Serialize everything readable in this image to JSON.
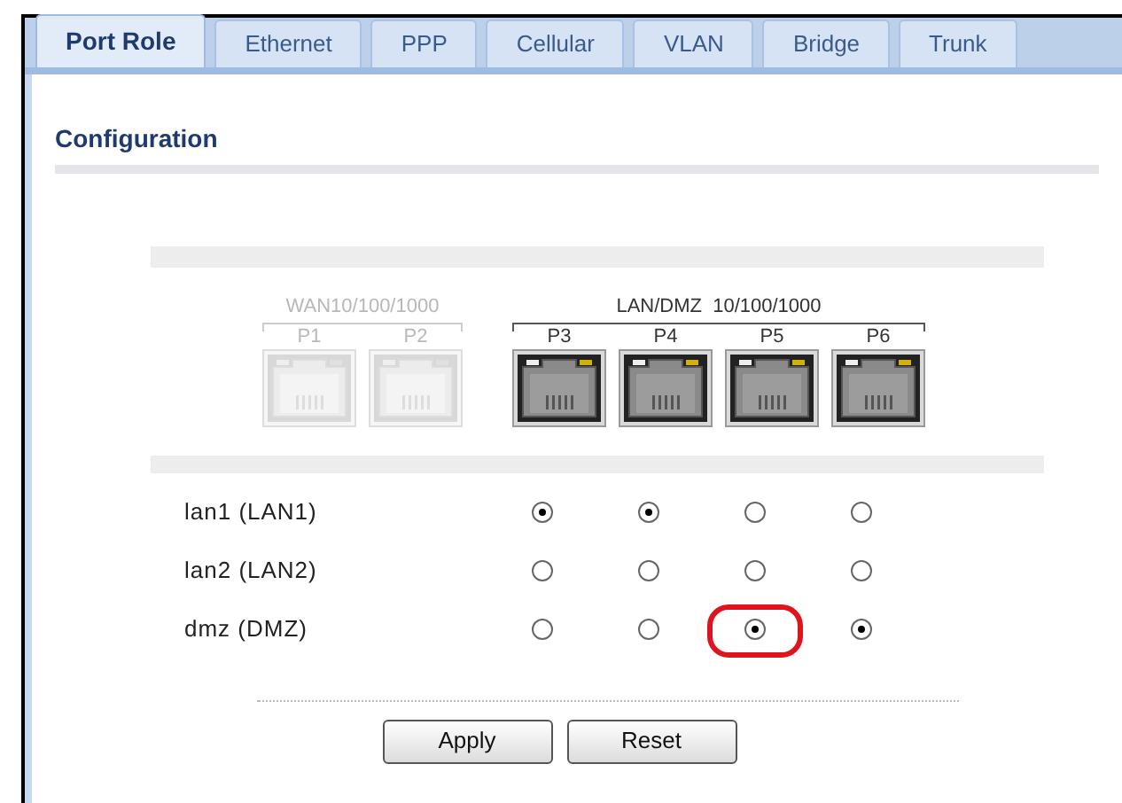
{
  "tabs": [
    {
      "label": "Port Role",
      "selected": true
    },
    {
      "label": "Ethernet",
      "selected": false
    },
    {
      "label": "PPP",
      "selected": false
    },
    {
      "label": "Cellular",
      "selected": false
    },
    {
      "label": "VLAN",
      "selected": false
    },
    {
      "label": "Bridge",
      "selected": false
    },
    {
      "label": "Trunk",
      "selected": false
    }
  ],
  "section_title": "Configuration",
  "port_groups": [
    {
      "label": "WAN10/100/1000",
      "ports": [
        {
          "name": "P1",
          "disabled": true
        },
        {
          "name": "P2",
          "disabled": true
        }
      ]
    },
    {
      "label": "LAN/DMZ  10/100/1000",
      "ports": [
        {
          "name": "P3",
          "disabled": false
        },
        {
          "name": "P4",
          "disabled": false
        },
        {
          "name": "P5",
          "disabled": false
        },
        {
          "name": "P6",
          "disabled": false
        }
      ]
    }
  ],
  "roles": [
    {
      "label": "lan1 (LAN1)",
      "options": [
        {
          "selected": true,
          "highlighted": false
        },
        {
          "selected": true,
          "highlighted": false
        },
        {
          "selected": false,
          "highlighted": false
        },
        {
          "selected": false,
          "highlighted": false
        }
      ]
    },
    {
      "label": "lan2 (LAN2)",
      "options": [
        {
          "selected": false,
          "highlighted": false
        },
        {
          "selected": false,
          "highlighted": false
        },
        {
          "selected": false,
          "highlighted": false
        },
        {
          "selected": false,
          "highlighted": false
        }
      ]
    },
    {
      "label": "dmz (DMZ)",
      "options": [
        {
          "selected": false,
          "highlighted": false
        },
        {
          "selected": false,
          "highlighted": false
        },
        {
          "selected": true,
          "highlighted": true
        },
        {
          "selected": true,
          "highlighted": false
        }
      ]
    }
  ],
  "buttons": [
    "Apply",
    "Reset"
  ]
}
